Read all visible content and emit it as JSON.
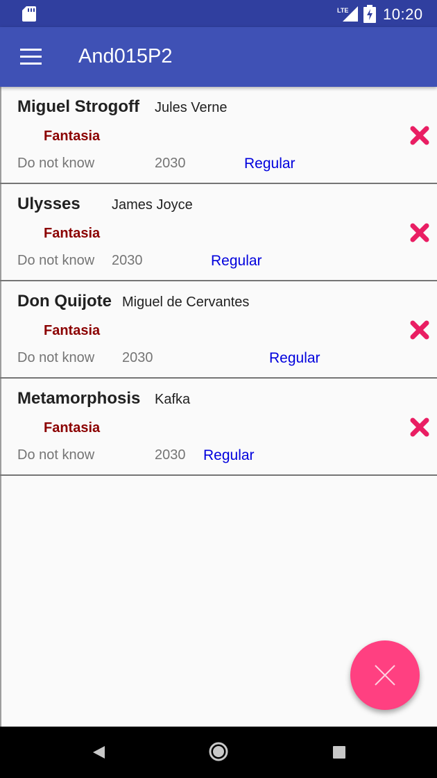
{
  "status_bar": {
    "time": "10:20",
    "network": "LTE",
    "icons": [
      "sd-card-icon",
      "lte-signal-icon",
      "battery-charging-icon"
    ]
  },
  "app_bar": {
    "title": "And015P2",
    "menu_icon": "hamburger-menu-icon"
  },
  "books": [
    {
      "title": "Miguel Strogoff",
      "author": "Jules Verne",
      "genre": "Fantasia",
      "status": "Do not know",
      "year": "2030",
      "rating": "Regular"
    },
    {
      "title": "Ulysses",
      "author": "James Joyce",
      "genre": "Fantasia",
      "status": "Do not know",
      "year": "2030",
      "rating": "Regular"
    },
    {
      "title": "Don Quijote",
      "author": "Miguel de Cervantes",
      "genre": "Fantasia",
      "status": "Do not know",
      "year": "2030",
      "rating": "Regular"
    },
    {
      "title": "Metamorphosis",
      "author": "Kafka",
      "genre": "Fantasia",
      "status": "Do not know",
      "year": "2030",
      "rating": "Regular"
    }
  ],
  "colors": {
    "primary": "#3f51b5",
    "primary_dark": "#303f9f",
    "accent": "#ff4081",
    "genre": "#8b0000",
    "rating": "#0000dd",
    "delete_icon": "#e91e63"
  },
  "fab": {
    "icon": "close-icon"
  },
  "nav_bar": {
    "icons": [
      "back-icon",
      "home-icon",
      "recents-icon"
    ]
  }
}
